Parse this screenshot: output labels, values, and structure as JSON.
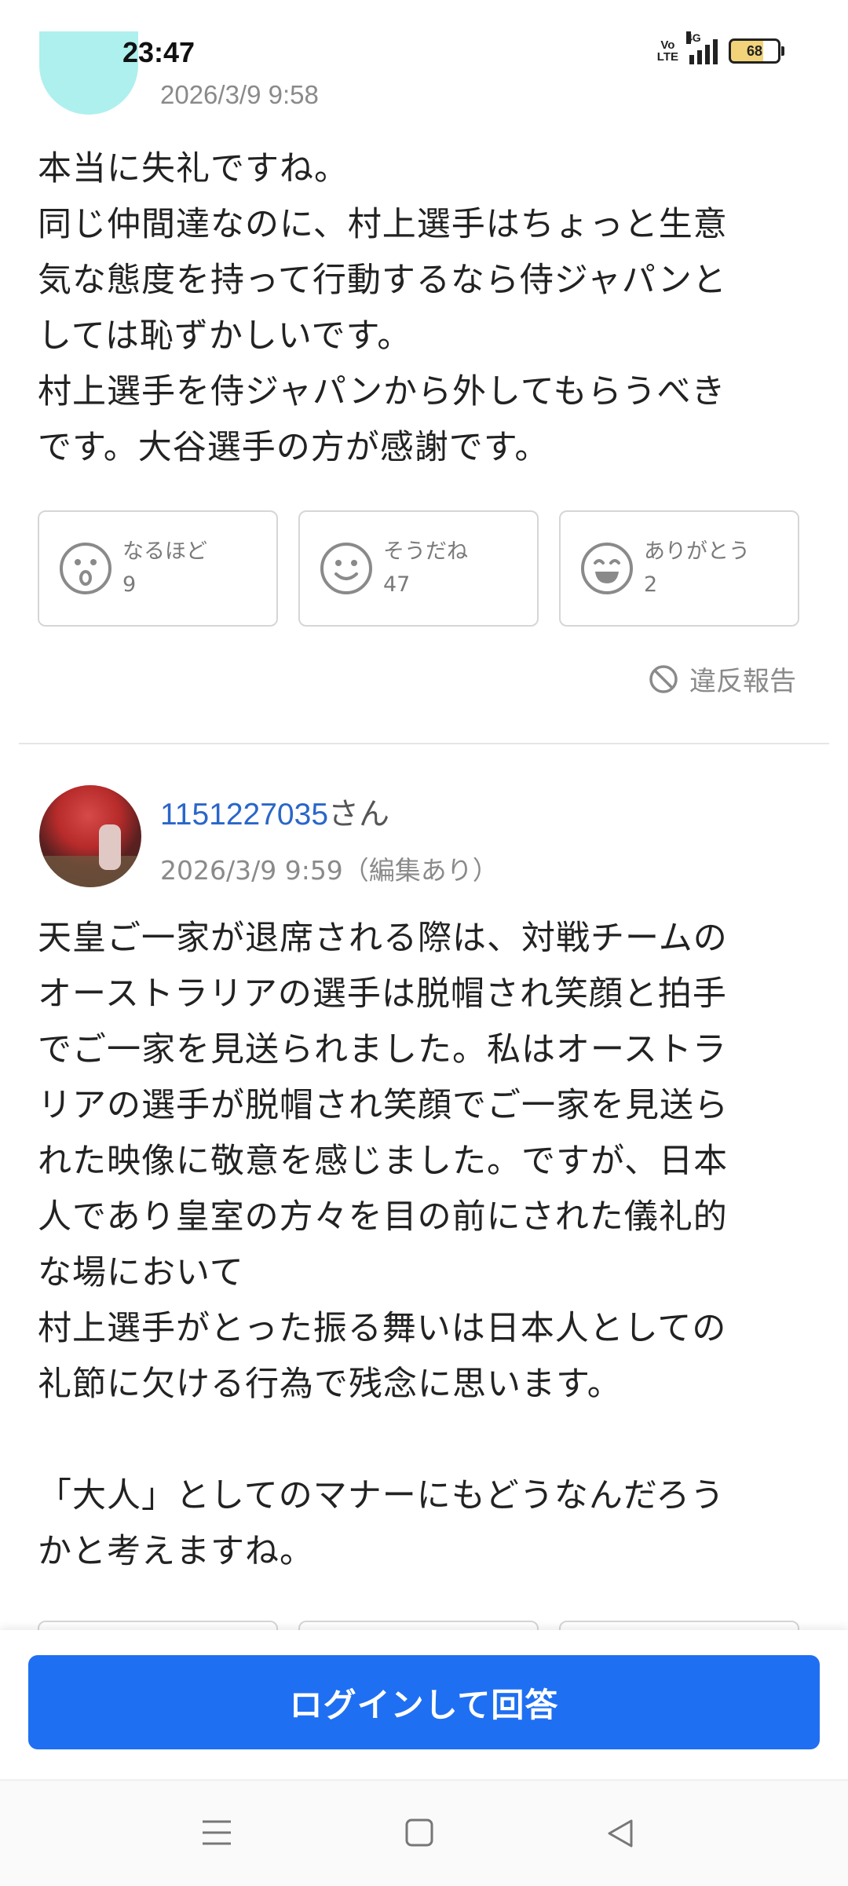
{
  "status_bar": {
    "time": "23:47",
    "network_label": "4G",
    "volte_label": "Vo\nLTE",
    "battery_level": "68"
  },
  "post1": {
    "date": "2026/3/9 9:58",
    "text": "本当に失礼ですね。\n同じ仲間達なのに、村上選手はちょっと生意\n気な態度を持って行動するなら侍ジャパンと\nしては恥ずかしいです。\n村上選手を侍ジャパンから外してもらうべき\nです。大谷選手の方が感謝です。",
    "reactions": [
      {
        "label": "なるほど",
        "count": "9",
        "icon": "surprised-face-icon"
      },
      {
        "label": "そうだね",
        "count": "47",
        "icon": "smile-face-icon"
      },
      {
        "label": "ありがとう",
        "count": "2",
        "icon": "grin-face-icon"
      }
    ],
    "report_label": "違反報告"
  },
  "post2": {
    "user_id": "1151227035",
    "user_suffix": "さん",
    "date": "2026/3/9 9:59（編集あり）",
    "text": "天皇ご一家が退席される際は、対戦チームの\nオーストラリアの選手は脱帽され笑顔と拍手\nでご一家を見送られました。私はオーストラ\nリアの選手が脱帽され笑顔でご一家を見送ら\nれた映像に敬意を感じました。ですが、日本\n人であり皇室の方々を目の前にされた儀礼的\nな場において\n村上選手がとった振る舞いは日本人としての\n礼節に欠ける行為で残念に思います。\n\n「大人」としてのマナーにもどうなんだろう\nかと考えますね。"
  },
  "bottom": {
    "login_button": "ログインして回答"
  },
  "colors": {
    "accent": "#1f6ff2",
    "link": "#2a66c9",
    "muted": "#8a8a8a"
  }
}
